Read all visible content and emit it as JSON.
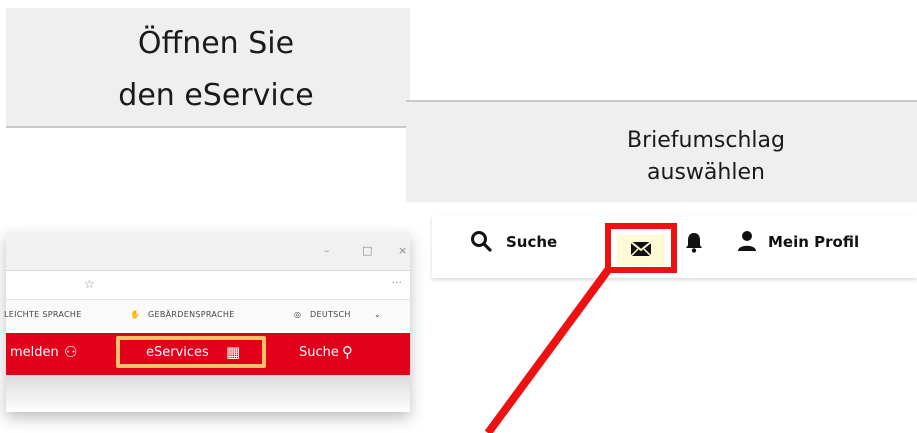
{
  "left_caption": {
    "line1": "Öffnen Sie",
    "line2": "den eService"
  },
  "browser": {
    "window_controls": [
      "–",
      "□",
      "×"
    ],
    "lang_bar": {
      "easy_language": "LEICHTE SPRACHE",
      "sign_language": "GEBÄRDENSPRACHE",
      "language": "DEUTSCH"
    },
    "nav": {
      "login": "melden",
      "eservices": "eServices",
      "search": "Suche"
    }
  },
  "right_caption": {
    "line1": "Briefumschlag",
    "line2": "auswählen"
  },
  "toolbar": {
    "search": "Suche",
    "profile": "Mein Profil"
  },
  "colors": {
    "nav_red": "#e2001a",
    "highlight_yellow": "#f3c26a",
    "callout_red": "#ee1111"
  },
  "icons": {
    "search": "search-icon",
    "mail": "envelope-icon",
    "bell": "bell-icon",
    "user": "user-icon",
    "grid": "grid-icon",
    "star": "star-icon"
  }
}
